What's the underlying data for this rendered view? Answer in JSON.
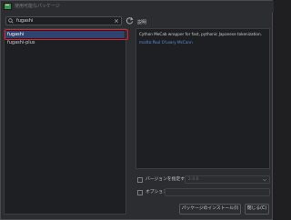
{
  "window": {
    "title": "使用可能なパッケージ"
  },
  "search": {
    "value": "fugashi",
    "placeholder": ""
  },
  "packages": [
    {
      "name": "fugashi",
      "selected": true
    },
    {
      "name": "fugashi-plus",
      "selected": false
    }
  ],
  "details": {
    "label": "説明",
    "description": "Cython MeCab wrapper for fast, pythonic Japanese tokenization.",
    "author_link": "mailto:Paul O'Leary McCann"
  },
  "options": {
    "version_label": "バージョンを指定する",
    "version_value": "2.4.0",
    "options_label": "オプション",
    "options_value": ""
  },
  "buttons": {
    "install": "パッケージのインストール(I)",
    "close": "閉じる(C)"
  },
  "colors": {
    "selection": "#2e436e",
    "highlight_outline": "#e0202e",
    "link": "#5c8fd8"
  }
}
